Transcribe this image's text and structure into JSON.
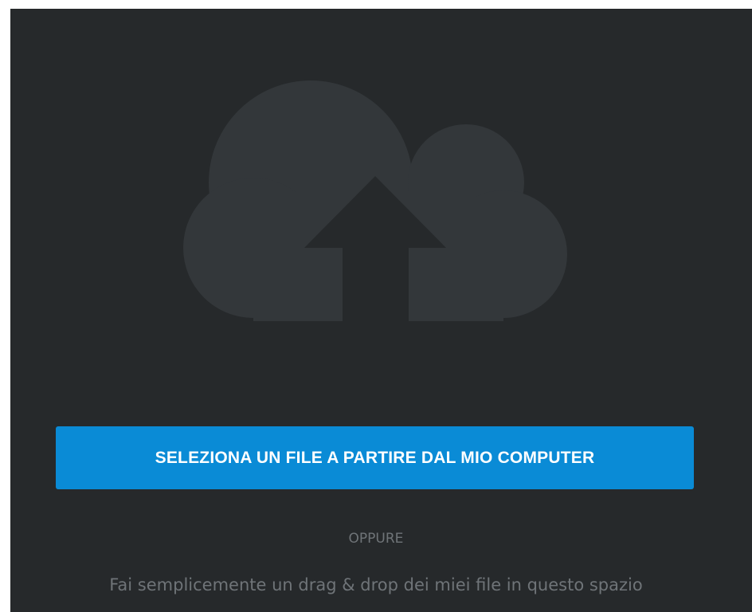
{
  "upload": {
    "icon": "cloud-upload-icon",
    "button_label": "SELEZIONA UN FILE A PARTIRE DAL MIO COMPUTER",
    "or_text": "OPPURE",
    "drop_hint": "Fai semplicemente un drag & drop dei miei file in questo spazio"
  },
  "colors": {
    "panel_background": "#26292b",
    "cloud": "#33373a",
    "button": "#0a8bd6",
    "button_text": "#ffffff",
    "muted_text": "#6f7478"
  }
}
